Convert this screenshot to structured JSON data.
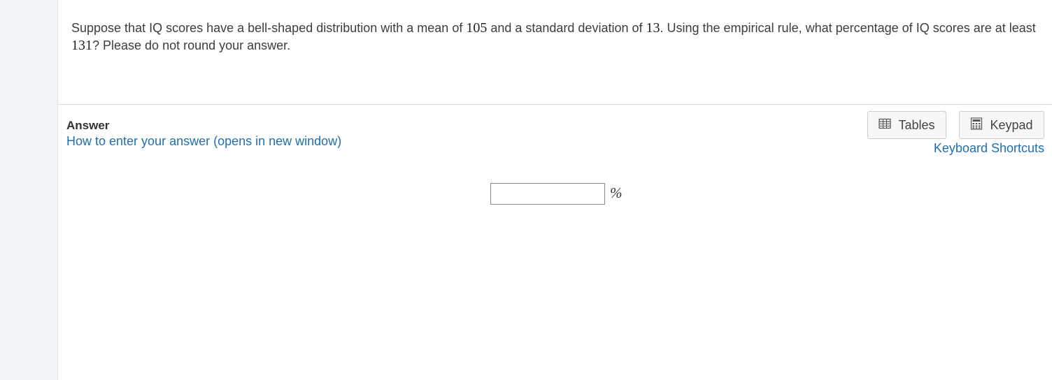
{
  "question": {
    "part1": "Suppose that IQ scores have a bell-shaped distribution with a mean of ",
    "mean": "105",
    "part2": " and a standard deviation of ",
    "sd": "13",
    "part3": ".  Using the empirical rule, what percentage of IQ scores are at least ",
    "threshold": "131",
    "part4": "?  Please do not round your answer."
  },
  "answer": {
    "label": "Answer",
    "howto_link": "How to enter your answer (opens in new window)",
    "input_value": "",
    "unit": "%"
  },
  "toolbar": {
    "tables_label": "Tables",
    "keypad_label": "Keypad",
    "tables_icon": "table-icon",
    "keypad_icon": "calculator-icon",
    "keyboard_shortcuts_label": "Keyboard Shortcuts"
  },
  "colors": {
    "link": "#1f6fb2",
    "sidebar": "#f0f4f7",
    "text": "#3d3d3d"
  }
}
